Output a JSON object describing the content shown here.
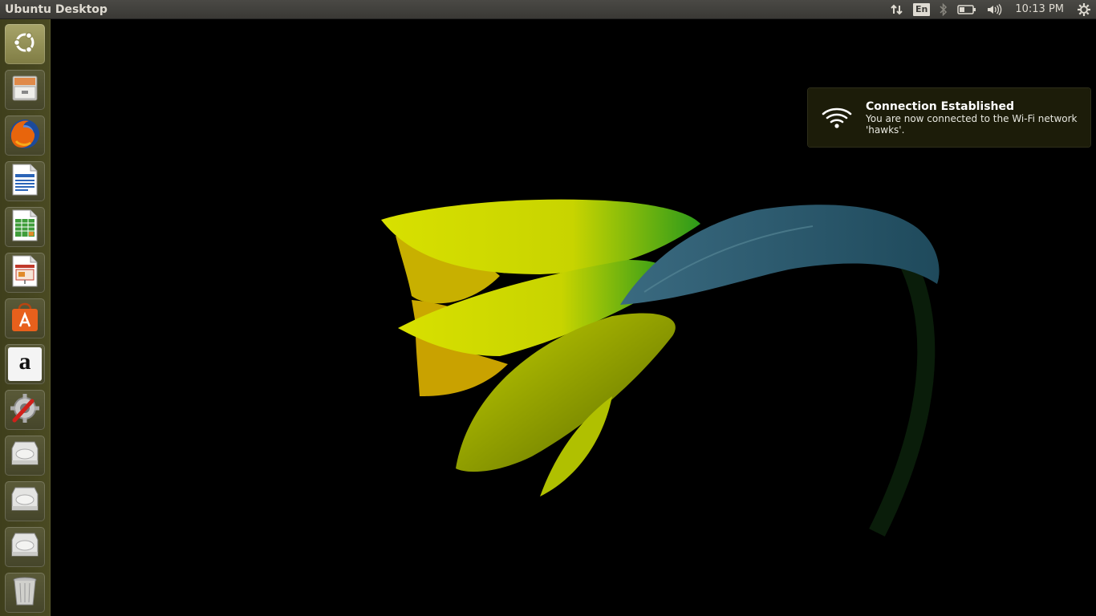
{
  "panel": {
    "title": "Ubuntu Desktop",
    "language": "En",
    "clock": "10:13 PM",
    "icons": [
      "network-transfer-icon",
      "keyboard-language-icon",
      "bluetooth-icon",
      "battery-icon",
      "volume-icon",
      "system-gear-icon"
    ]
  },
  "launcher": {
    "items": [
      {
        "name": "dash-home",
        "icon": "ubuntu-logo-icon"
      },
      {
        "name": "files",
        "icon": "file-cabinet-icon"
      },
      {
        "name": "firefox",
        "icon": "firefox-icon"
      },
      {
        "name": "libreoffice-writer",
        "icon": "writer-document-icon"
      },
      {
        "name": "libreoffice-calc",
        "icon": "calc-spreadsheet-icon"
      },
      {
        "name": "libreoffice-impress",
        "icon": "impress-presentation-icon"
      },
      {
        "name": "ubuntu-software-center",
        "icon": "software-bag-icon"
      },
      {
        "name": "amazon",
        "icon": "amazon-icon"
      },
      {
        "name": "system-settings",
        "icon": "settings-wrench-icon"
      },
      {
        "name": "drive-1",
        "icon": "hard-drive-icon"
      },
      {
        "name": "drive-2",
        "icon": "hard-drive-icon"
      },
      {
        "name": "drive-3",
        "icon": "hard-drive-icon"
      },
      {
        "name": "trash",
        "icon": "trash-icon"
      }
    ]
  },
  "amazon_glyph": "a",
  "notification": {
    "title": "Connection Established",
    "body": "You are now connected to the Wi-Fi network 'hawks'.",
    "icon": "wifi-icon"
  },
  "wallpaper": {
    "subject": "yellow-daffodil-flower",
    "background": "#000000"
  }
}
